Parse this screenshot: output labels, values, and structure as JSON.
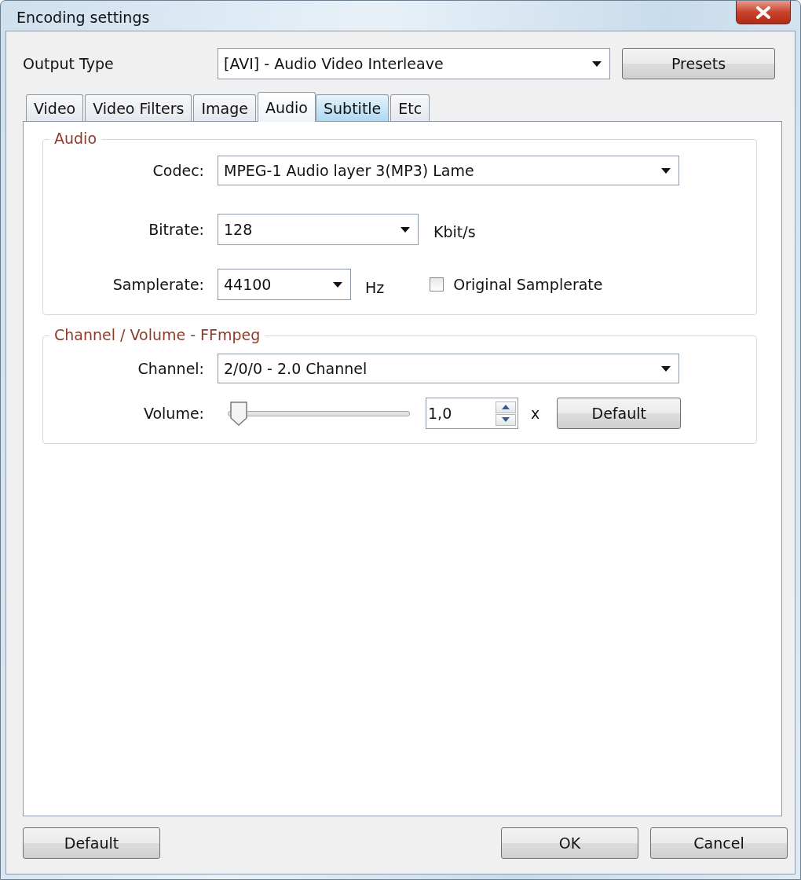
{
  "window": {
    "title": "Encoding settings"
  },
  "output_type": {
    "label": "Output Type",
    "value": "[AVI] - Audio Video Interleave",
    "button": "Presets"
  },
  "tabs": [
    {
      "label": "Video",
      "selected": false,
      "hovered": false
    },
    {
      "label": "Video Filters",
      "selected": false,
      "hovered": false
    },
    {
      "label": "Image",
      "selected": false,
      "hovered": false
    },
    {
      "label": "Audio",
      "selected": true,
      "hovered": false
    },
    {
      "label": "Subtitle",
      "selected": false,
      "hovered": true
    },
    {
      "label": "Etc",
      "selected": false,
      "hovered": false
    }
  ],
  "audio_group": {
    "title": "Audio",
    "codec": {
      "label": "Codec:",
      "value": "MPEG-1 Audio layer 3(MP3) Lame"
    },
    "bitrate": {
      "label": "Bitrate:",
      "value": "128",
      "unit": "Kbit/s"
    },
    "samplerate": {
      "label": "Samplerate:",
      "value": "44100",
      "unit": "Hz"
    },
    "original_samplerate": {
      "label": "Original Samplerate",
      "checked": false
    }
  },
  "channel_group": {
    "title": "Channel / Volume - FFmpeg",
    "channel": {
      "label": "Channel:",
      "value": "2/0/0 - 2.0 Channel"
    },
    "volume": {
      "label": "Volume:",
      "level": 0.06,
      "value": "1,0",
      "unit": "x",
      "button": "Default"
    }
  },
  "footer": {
    "left": [
      "Default"
    ],
    "right": [
      "OK",
      "Cancel"
    ]
  }
}
